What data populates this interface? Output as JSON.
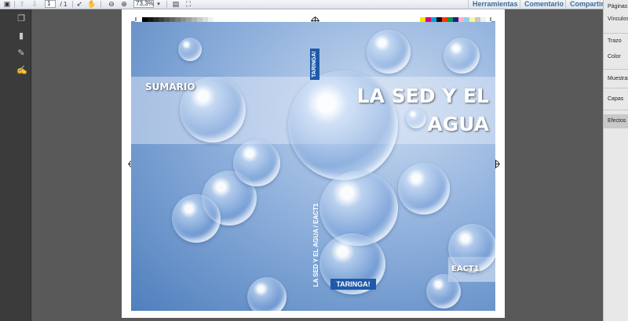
{
  "toolbar": {
    "page_current": "1",
    "page_total": "/ 1",
    "zoom": "73,3%",
    "links": [
      "Herramientas",
      "Comentario",
      "Compartir"
    ]
  },
  "cover": {
    "sumario": "SUMARIO",
    "title_line1": "LA SED Y EL",
    "title_line2": "AGUA",
    "spine_top_logo": "TARINGA!",
    "spine_text": "LA SED Y EL AGUA / EACT1",
    "bottom_logo": "TARINGA!",
    "code": "EACT1"
  },
  "colors": {
    "grayscale": [
      "#000000",
      "#141414",
      "#282828",
      "#3c3c3c",
      "#505050",
      "#646464",
      "#787878",
      "#8c8c8c",
      "#a0a0a0",
      "#b4b4b4",
      "#c8c8c8",
      "#dcdcdc",
      "#f0f0f0"
    ],
    "process": [
      "#ffe600",
      "#e4007c",
      "#00a0e9",
      "#111111",
      "#ff3300",
      "#009944",
      "#1d2088",
      "#ffb0c8",
      "#8cd3f5",
      "#fff49b",
      "#c8c8c8",
      "#f0f0f0"
    ]
  },
  "right_panel": {
    "items": [
      "Páginas",
      "Vínculos",
      "Trazo",
      "Color",
      "Muestras",
      "Capas",
      "Efectos"
    ]
  }
}
